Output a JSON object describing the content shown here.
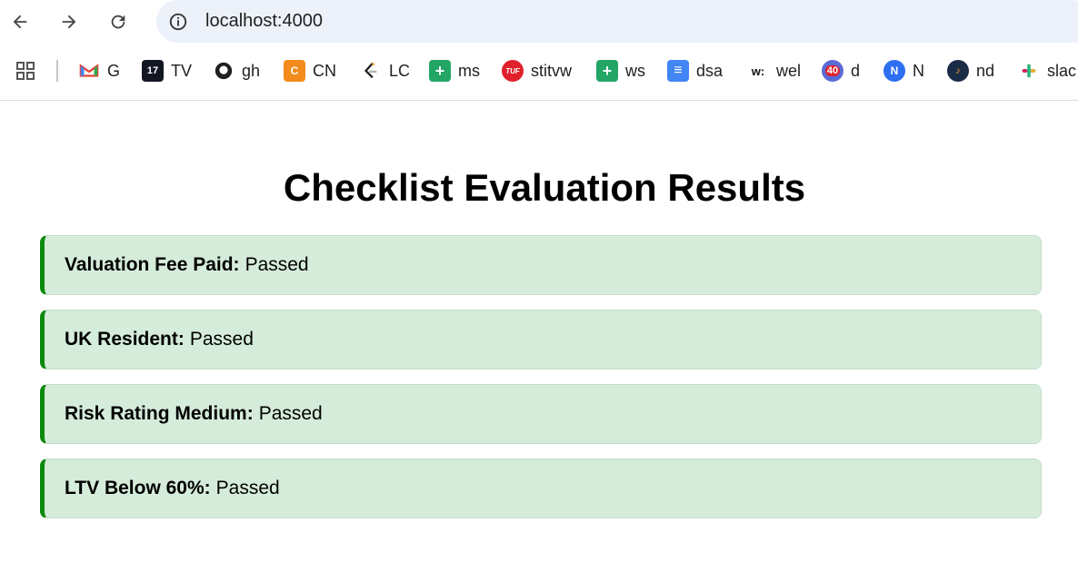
{
  "browser": {
    "url": "localhost:4000",
    "bookmarks": [
      {
        "label": "G",
        "icon": "gmail-icon"
      },
      {
        "label": "TV",
        "icon": "tradingview-icon"
      },
      {
        "label": "gh",
        "icon": "github-icon"
      },
      {
        "label": "CN",
        "icon": "codingninjas-icon"
      },
      {
        "label": "LC",
        "icon": "leetcode-icon"
      },
      {
        "label": "ms",
        "icon": "sheets-plus-icon"
      },
      {
        "label": "stitvw",
        "icon": "tuf-icon",
        "icon_text": "TUF"
      },
      {
        "label": "ws",
        "icon": "sheets-plus-icon"
      },
      {
        "label": "dsa",
        "icon": "docs-icon"
      },
      {
        "label": "wel",
        "icon": "w-icon",
        "icon_text": "w:"
      },
      {
        "label": "d",
        "icon": "badge-40-icon",
        "icon_text": "40"
      },
      {
        "label": "N",
        "icon": "n-app-icon"
      },
      {
        "label": "nd",
        "icon": "nd-app-icon"
      },
      {
        "label": "slac",
        "icon": "slack-icon"
      }
    ]
  },
  "page": {
    "title": "Checklist Evaluation Results",
    "items": [
      {
        "label": "Valuation Fee Paid:",
        "status": "Passed"
      },
      {
        "label": "UK Resident:",
        "status": "Passed"
      },
      {
        "label": "Risk Rating Medium:",
        "status": "Passed"
      },
      {
        "label": "LTV Below 60%:",
        "status": "Passed"
      }
    ]
  },
  "colors": {
    "item_bg": "#d5ecda",
    "item_accent": "#0d8a0d",
    "omnibox_bg": "#edf2fa"
  }
}
